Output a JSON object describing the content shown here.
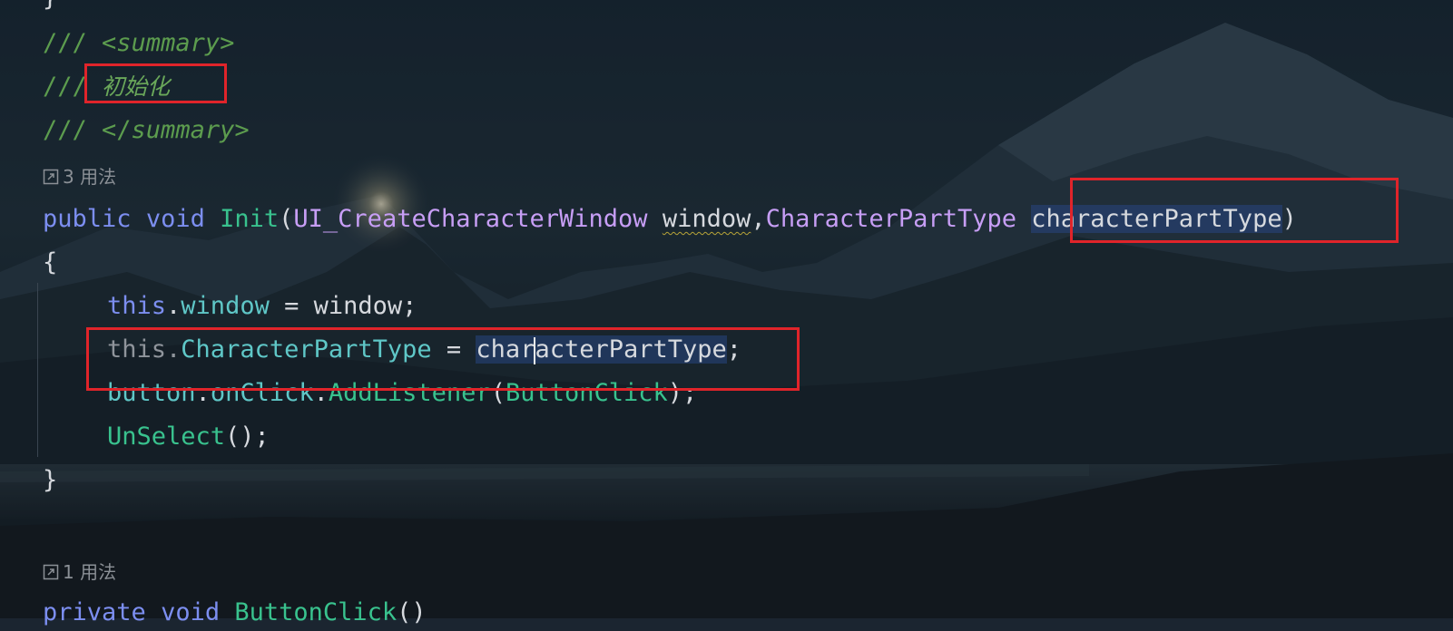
{
  "code": {
    "doc_open": {
      "prefix": "/// ",
      "lt": "<",
      "tag": "summary",
      "gt": ">"
    },
    "doc_text": {
      "prefix": "/// ",
      "text": "初始化"
    },
    "doc_close": {
      "prefix": "/// ",
      "lt": "</",
      "tag": "summary",
      "gt": ">"
    },
    "usage_hint_1": "3 用法",
    "signature": {
      "modifier": "public",
      "return_type": "void",
      "method_name": "Init",
      "open_paren": "(",
      "param1_type": "UI_CreateCharacterWindow",
      "param1_name": "window",
      "comma": ",",
      "param2_type": "CharacterPartType",
      "param2_name": "characterPartType",
      "close_paren": ")"
    },
    "open_brace": "{",
    "stmt1": {
      "this": "this",
      "dot": ".",
      "field": "window",
      "rest": " = window;"
    },
    "stmt2": {
      "this": "this",
      "dot": ".",
      "field": "CharacterPartType",
      "eq": " = ",
      "value_before_caret": "char",
      "value_after_caret": "acterPartType",
      "semi": ";"
    },
    "stmt3": {
      "obj": "button",
      "dot1": ".",
      "evt": "onClick",
      "dot2": ".",
      "method": "AddListener",
      "open": "(",
      "arg": "ButtonClick",
      "close": ");"
    },
    "stmt4": {
      "method": "UnSelect",
      "rest": "();"
    },
    "close_brace": "}",
    "usage_hint_2": "1 用法",
    "next_line": {
      "modifier": "private",
      "return_type": "void",
      "method_name": "ButtonClick",
      "parens": "()"
    }
  },
  "colors": {
    "keyword": "#7c8ef0",
    "method": "#39c28e",
    "class": "#c79ef5",
    "property": "#5fc7c7",
    "doc_comment": "#5c9c4e",
    "annotation_box": "#e0242a"
  }
}
